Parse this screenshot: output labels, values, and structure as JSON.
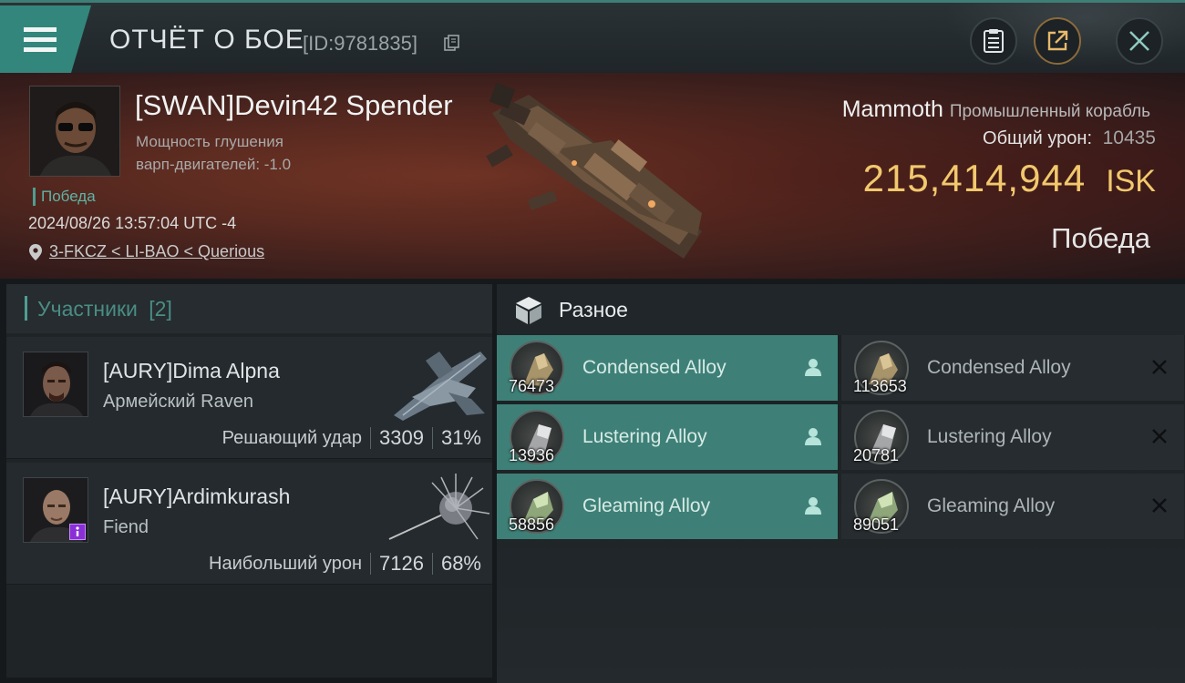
{
  "header": {
    "title": "ОТЧЁТ О БОЕ",
    "report_id": "[ID:9781835]",
    "icons": [
      "menu-icon",
      "copy-icon",
      "report-icon",
      "share-icon",
      "close-icon"
    ]
  },
  "victim": {
    "name": "[SWAN]Devin42 Spender",
    "stat_line1": "Мощность глушения",
    "stat_line2": "варп-двигателей: -1.0",
    "result_tag": "Победа",
    "datetime": "2024/08/26 13:57:04 UTC -4",
    "location": "3-FKCZ < LI-BAO < Querious",
    "ship_name": "Mammoth",
    "ship_class": "Промышленный корабль",
    "total_damage_label": "Общий урон:",
    "total_damage": "10435",
    "isk_value": "215,414,944",
    "isk_unit": "ISK",
    "result": "Победа"
  },
  "participants": {
    "label": "Участники",
    "count": "[2]",
    "list": [
      {
        "name": "[AURY]Dima Alpna",
        "ship": "Армейский Raven",
        "role": "Решающий удар",
        "damage": "3309",
        "percent": "31%"
      },
      {
        "name": "[AURY]Ardimkurash",
        "ship": "Fiend",
        "role": "Наибольший урон",
        "damage": "7126",
        "percent": "68%"
      }
    ]
  },
  "misc": {
    "label": "Разное",
    "dropped": [
      {
        "name": "Condensed Alloy",
        "qty": "76473"
      },
      {
        "name": "Lustering Alloy",
        "qty": "13936"
      },
      {
        "name": "Gleaming Alloy",
        "qty": "58856"
      }
    ],
    "destroyed": [
      {
        "name": "Condensed Alloy",
        "qty": "113653"
      },
      {
        "name": "Lustering Alloy",
        "qty": "20781"
      },
      {
        "name": "Gleaming Alloy",
        "qty": "89051"
      }
    ]
  },
  "colors": {
    "accent": "#3e8077",
    "isk": "#f2c86d",
    "background": "#16191c"
  }
}
